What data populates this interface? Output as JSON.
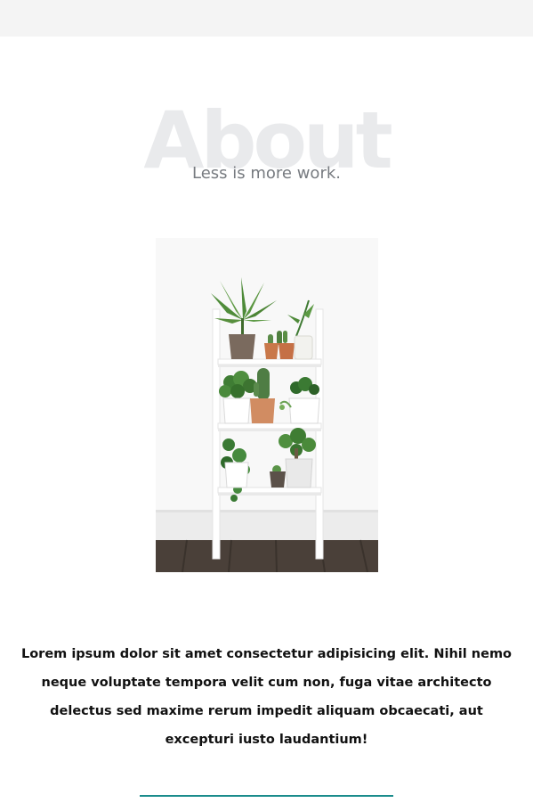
{
  "about": {
    "watermark": "About",
    "subtitle": "Less is more work.",
    "image_alt": "White ladder shelf with potted plants",
    "paragraph": "Lorem ipsum dolor sit amet consectetur adipisicing elit. Nihil nemo neque voluptate tempora velit cum non, fuga vitae architecto delectus sed maxime rerum impedit aliquam obcaecati, aut excepturi iusto laudantium!"
  },
  "colors": {
    "accent": "#1b8c8c",
    "topbar": "#f4f4f4",
    "watermark": "#e9eaec",
    "subtitle": "#777b80",
    "text": "#111111"
  }
}
